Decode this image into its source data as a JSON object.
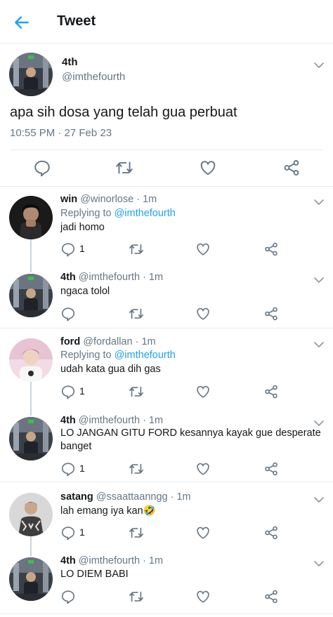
{
  "header": {
    "title": "Tweet",
    "back_icon": "arrow-left-icon",
    "accent": "#1da1f2"
  },
  "main_tweet": {
    "name": "4th",
    "handle": "@imthefourth",
    "text": "apa sih dosa yang telah gua perbuat",
    "time": "10:55 PM · 27 Feb 23"
  },
  "replies": [
    {
      "name": "win",
      "handle": "@winorlose",
      "time": "· 1m",
      "replying_label": "Replying to",
      "replying_to": "@imthefourth",
      "text": "jadi homo",
      "reply_count": "1"
    },
    {
      "name": "4th",
      "handle": "@imthefourth",
      "time": "· 1m",
      "text": "ngaca tolol"
    },
    {
      "name": "ford",
      "handle": "@fordallan",
      "time": "· 1m",
      "replying_label": "Replying to",
      "replying_to": "@imthefourth",
      "text": "udah kata gua dih gas",
      "reply_count": "1"
    },
    {
      "name": "4th",
      "handle": "@imthefourth",
      "time": "· 1m",
      "text": "LO JANGAN GITU FORD kesannya kayak gue desperate banget",
      "reply_count": "1"
    },
    {
      "name": "satang",
      "handle": "@ssaattaanngg",
      "time": "· 1m",
      "text": "lah emang iya kan🤣",
      "reply_count": "1"
    },
    {
      "name": "4th",
      "handle": "@imthefourth",
      "time": "· 1m",
      "text": "LO DIEM BABI"
    }
  ],
  "colors": {
    "text": "#14171a",
    "secondary": "#657786",
    "mention": "#1da1f2",
    "divider": "#e6ecf0",
    "icon": "#657786"
  }
}
